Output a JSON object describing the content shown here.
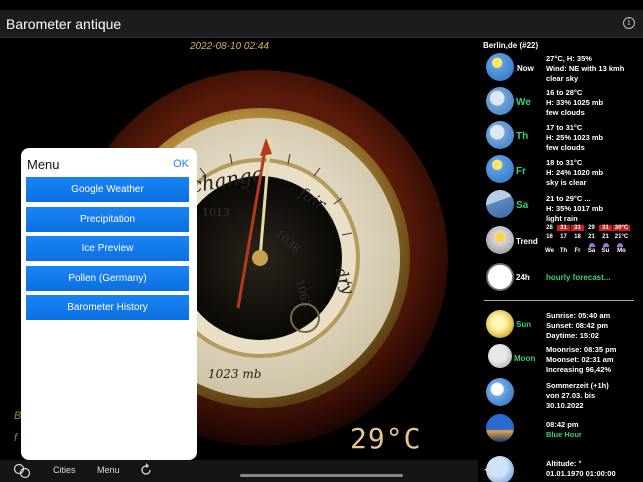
{
  "app": {
    "title": "Barometer antique"
  },
  "main": {
    "datetime": "2022-08-10 02:44",
    "temperature": "29°C",
    "dial": {
      "change": "change",
      "fair": "fair",
      "dry": "dry",
      "t1013": "1013",
      "t1038": "1038",
      "t1063": "1063",
      "unit": "1023 mb"
    },
    "left_hint1": "B",
    "left_hint2": "f"
  },
  "menu": {
    "title": "Menu",
    "ok": "OK",
    "items": [
      "Google Weather",
      "Precipitation",
      "Ice Preview",
      "Pollen (Germany)",
      "Barometer History"
    ]
  },
  "tabbar": {
    "cities": "Cities",
    "menu": "Menu"
  },
  "forecast": {
    "city": "Berlin,de (#22)",
    "now": {
      "label": "Now",
      "text": "27°C, H: 35%\nWind: NE with 13 kmh\nclear sky"
    },
    "days": [
      {
        "label": "We",
        "text": "16 to 28°C\nH: 33% 1025 mb\nfew clouds"
      },
      {
        "label": "Th",
        "text": "17 to 31°C\nH: 25% 1023 mb\nfew clouds"
      },
      {
        "label": "Fr",
        "text": "18 to 31°C\nH: 24% 1020 mb\nsky is clear"
      },
      {
        "label": "Sa",
        "text": "21 to 29°C ...\nH: 35% 1017 mb\nlight rain"
      }
    ],
    "trend": {
      "label": "Trend",
      "highs": [
        "28",
        "31",
        "31",
        "29",
        "31",
        "30°C"
      ],
      "lows": [
        "16",
        "17",
        "18",
        "21",
        "21",
        "21°C"
      ],
      "days": [
        "We",
        "Th",
        "Fr",
        "Sa",
        "Su",
        "Mo"
      ]
    },
    "hourly": {
      "label": "24h",
      "text": "hourly forecast..."
    },
    "sun": {
      "label": "Sun",
      "text": "Sunrise: 05:40 am\nSunset: 08:42 pm\nDaytime: 15:02"
    },
    "moon": {
      "label": "Moon",
      "text": "Moonrise: 08:35 pm\nMoonset: 02:31 am\nIncreasing 96,42%"
    },
    "dst": {
      "text": "Sommerzeit (+1h)\nvon 27.03. bis\n30.10.2022"
    },
    "bluehour": {
      "time": "08:42 pm",
      "label": "Blue Hour"
    },
    "altitude": {
      "text": "Altitude: °\n01.01.1970 01:00:00"
    }
  },
  "colors": {
    "accent": "#1e7cf6",
    "day_label": "#3cd070",
    "gold": "#d9b35a"
  }
}
